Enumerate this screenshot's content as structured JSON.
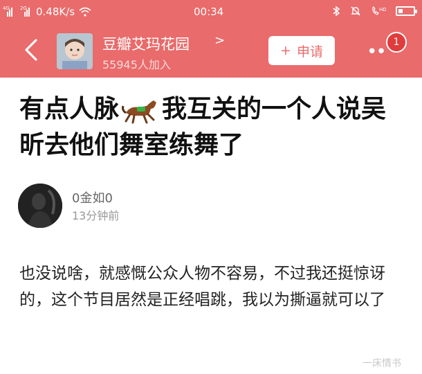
{
  "status_bar": {
    "net_a": "4G",
    "net_b": "2G",
    "speed": "0.48K/s",
    "time": "00:34",
    "battery_level": 0.3
  },
  "header": {
    "group_name": "豆瓣艾玛花园",
    "group_chevron": ">",
    "members": "55945人加入",
    "apply_plus": "+",
    "apply_label": "申请",
    "more": "••",
    "badge_count": "1"
  },
  "post": {
    "title_part1": "有点人脉",
    "title_part2": "我互关的一个人说吴昕去他们舞室练舞了",
    "author_name": "0金如0",
    "timestamp": "13分钟前",
    "body": "也没说啥，就感慨公众人物不容易，不过我还挺惊讶的，这个节目居然是正经唱跳，我以为撕逼就可以了"
  },
  "watermark": "一床情书",
  "colors": {
    "accent": "#e96b6b",
    "badge": "#e13c3c"
  }
}
